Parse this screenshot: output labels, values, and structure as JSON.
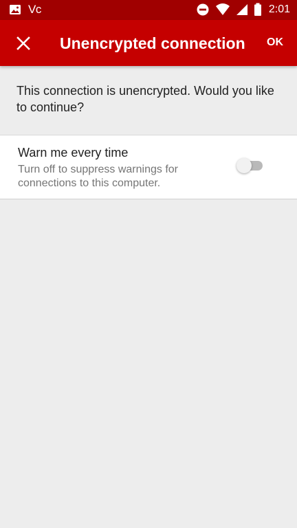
{
  "status_bar": {
    "left_icons": [
      "image-icon",
      "vc-text-icon"
    ],
    "vc_text": "V",
    "right_icons": [
      "do-not-disturb-icon",
      "wifi-icon",
      "cell-signal-icon",
      "battery-icon"
    ],
    "time": "2:01"
  },
  "app_bar": {
    "close_icon": "close-icon",
    "title": "Unencrypted connection",
    "ok_label": "OK"
  },
  "dialog": {
    "message": "This connection is unencrypted. Would you like to continue?"
  },
  "setting": {
    "title": "Warn me every time",
    "description": "Turn off to suppress warnings for connections to this computer.",
    "toggle_on": false
  },
  "colors": {
    "status_bar": "#a00000",
    "app_bar": "#c50000",
    "background": "#ededed",
    "card": "#ffffff"
  }
}
